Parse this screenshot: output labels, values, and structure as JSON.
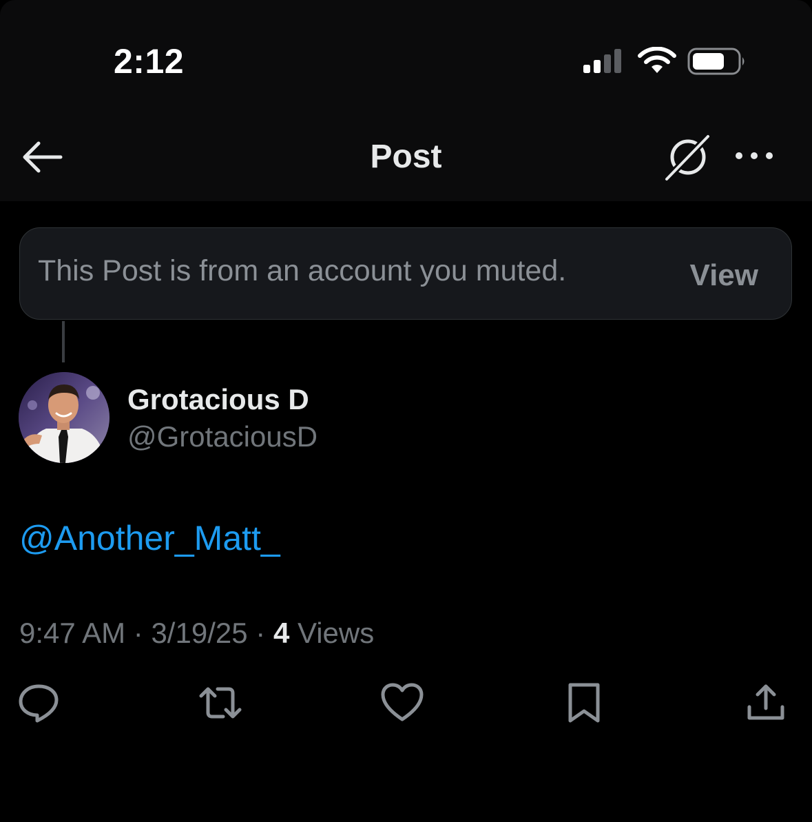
{
  "status_bar": {
    "time": "2:12",
    "icons": [
      "cellular-signal-icon",
      "wifi-icon",
      "battery-icon"
    ]
  },
  "nav": {
    "title": "Post",
    "back_icon": "back-arrow-icon",
    "grok_icon": "grok-icon",
    "more_icon": "more-options-icon"
  },
  "muted_banner": {
    "text": "This Post is from an account you muted.",
    "action_label": "View"
  },
  "post": {
    "author": {
      "display_name": "Grotacious D",
      "handle": "@GrotaciousD"
    },
    "text": "@Another_Matt_",
    "time": "9:47 AM",
    "date": "3/19/25",
    "separator": "·",
    "views_count": "4",
    "views_label": "Views"
  },
  "actions": [
    "reply-icon",
    "repost-icon",
    "like-icon",
    "bookmark-icon",
    "share-icon"
  ],
  "colors": {
    "background": "#000000",
    "bar_background": "#0b0b0c",
    "primary_text": "#e7e9ea",
    "secondary_text": "#71767b",
    "link": "#1d9bf0",
    "banner_background": "#16181c"
  }
}
